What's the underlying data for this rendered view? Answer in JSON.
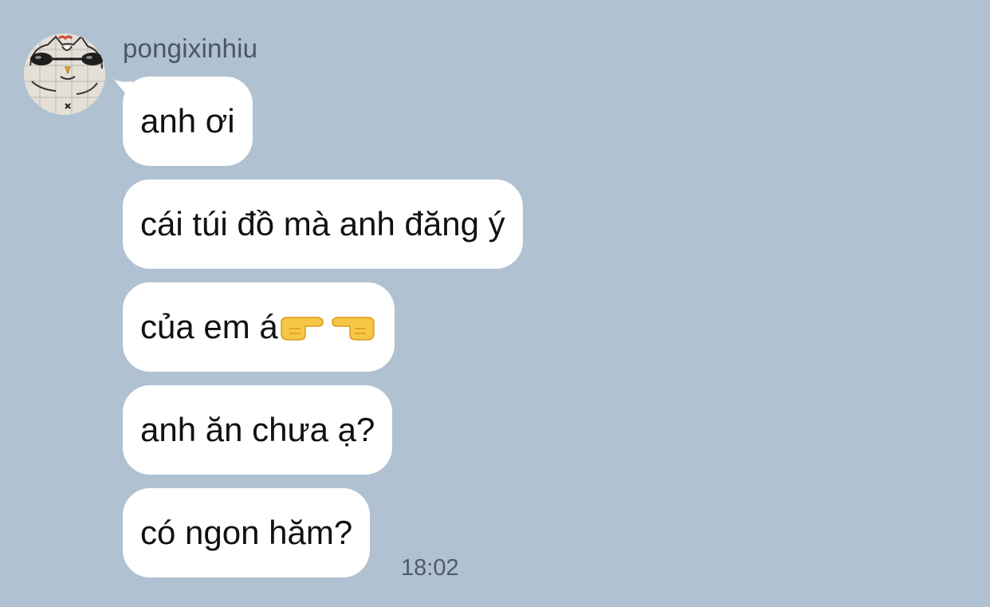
{
  "chat": {
    "sender_name": "pongixinhiu",
    "avatar_icon": "doodle-cat-avatar-icon",
    "timestamp": "18:02",
    "messages": [
      {
        "text": "anh ơi"
      },
      {
        "text": "cái túi đồ mà anh đăng ý"
      },
      {
        "text": "của em á",
        "emoji_icons": [
          "pointing-right-hand-icon",
          "pointing-left-hand-icon"
        ]
      },
      {
        "text": "anh ăn chưa ạ?"
      },
      {
        "text": "có ngon hăm?"
      }
    ]
  },
  "colors": {
    "background": "#b0c1d1",
    "bubble": "#ffffff",
    "text": "#111111",
    "meta_text": "#4f5b68"
  }
}
